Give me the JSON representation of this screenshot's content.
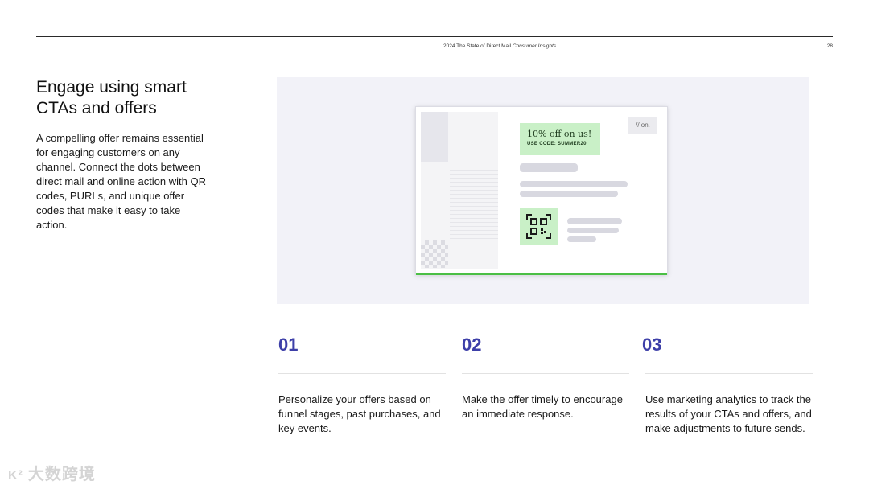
{
  "header": {
    "title": "2024 The State of Direct Mail",
    "title_italic": "Consumer Insights",
    "page_number": "28"
  },
  "intro": {
    "heading": "Engage using smart CTAs and offers",
    "body": "A compelling offer remains essential for engaging customers on any channel. Connect the dots between direct mail and online action with QR codes, PURLs, and unique offer codes that make it easy to take action."
  },
  "illustration": {
    "offer_title": "10% off on us!",
    "offer_code": "USE CODE: SUMMER20",
    "logo": "// on.",
    "colors": {
      "background": "#f2f2f8",
      "offer_badge": "#c9f0c7",
      "accent_bar": "#4bbf45"
    }
  },
  "steps": [
    {
      "number": "01",
      "text": "Personalize your offers based on funnel stages, past purchases, and key events."
    },
    {
      "number": "02",
      "text": "Make the offer timely to encourage an immediate response."
    },
    {
      "number": "03",
      "text": "Use marketing analytics to track the results of your CTAs and offers, and make adjustments to future sends."
    }
  ],
  "watermark": {
    "mark": "K²",
    "text": "大数跨境"
  },
  "colors": {
    "step_number": "#3d3fa8"
  }
}
